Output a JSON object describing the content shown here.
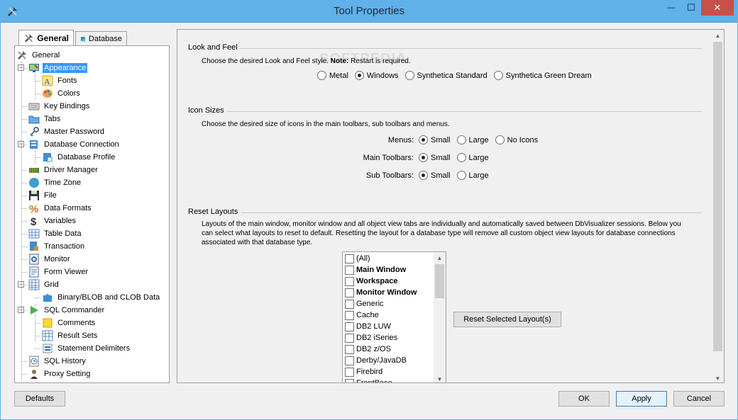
{
  "window": {
    "title": "Tool Properties",
    "minimize_glyph": "—",
    "maximize_glyph": "☐",
    "close_glyph": "✕"
  },
  "tabs": [
    {
      "label": "General",
      "icon": "wrench-screwdriver-icon",
      "active": true
    },
    {
      "label": "Database",
      "icon": "database-icon",
      "active": false
    }
  ],
  "tree": [
    {
      "label": "General",
      "icon": "wrench-screwdriver-icon",
      "level": 0
    },
    {
      "label": "Appearance",
      "icon": "monitor-paint-icon",
      "level": 1,
      "selected": true,
      "expanded": true
    },
    {
      "label": "Fonts",
      "icon": "font-icon",
      "level": 2
    },
    {
      "label": "Colors",
      "icon": "palette-icon",
      "level": 2
    },
    {
      "label": "Key Bindings",
      "icon": "keyboard-icon",
      "level": 1
    },
    {
      "label": "Tabs",
      "icon": "folder-tab-icon",
      "level": 1
    },
    {
      "label": "Master Password",
      "icon": "key-icon",
      "level": 1
    },
    {
      "label": "Database Connection",
      "icon": "database-connection-icon",
      "level": 1,
      "expanded": true
    },
    {
      "label": "Database Profile",
      "icon": "database-profile-icon",
      "level": 2
    },
    {
      "label": "Driver Manager",
      "icon": "driver-icon",
      "level": 1
    },
    {
      "label": "Time Zone",
      "icon": "globe-icon",
      "level": 1
    },
    {
      "label": "File",
      "icon": "floppy-disk-icon",
      "level": 1
    },
    {
      "label": "Data Formats",
      "icon": "percent-icon",
      "level": 1
    },
    {
      "label": "Variables",
      "icon": "dollar-icon",
      "level": 1
    },
    {
      "label": "Table Data",
      "icon": "table-icon",
      "level": 1
    },
    {
      "label": "Transaction",
      "icon": "transaction-icon",
      "level": 1
    },
    {
      "label": "Monitor",
      "icon": "monitor-icon",
      "level": 1
    },
    {
      "label": "Form Viewer",
      "icon": "form-icon",
      "level": 1
    },
    {
      "label": "Grid",
      "icon": "grid-icon",
      "level": 1,
      "expanded": true
    },
    {
      "label": "Binary/BLOB and CLOB Data",
      "icon": "puzzle-icon",
      "level": 2
    },
    {
      "label": "SQL Commander",
      "icon": "play-icon",
      "level": 1,
      "expanded": true
    },
    {
      "label": "Comments",
      "icon": "note-icon",
      "level": 2
    },
    {
      "label": "Result Sets",
      "icon": "result-grid-icon",
      "level": 2
    },
    {
      "label": "Statement Delimiters",
      "icon": "delimiter-icon",
      "level": 2
    },
    {
      "label": "SQL History",
      "icon": "clock-icon",
      "level": 1
    },
    {
      "label": "Proxy Setting",
      "icon": "person-icon",
      "level": 1
    }
  ],
  "look_and_feel": {
    "title": "Look and Feel",
    "desc_prefix": "Choose the desired Look and Feel style.",
    "desc_note_label": "Note:",
    "desc_note": "Restart is required.",
    "options": [
      {
        "label": "Metal",
        "checked": false
      },
      {
        "label": "Windows",
        "checked": true
      },
      {
        "label": "Synthetica Standard",
        "checked": false
      },
      {
        "label": "Synthetica Green Dream",
        "checked": false
      }
    ]
  },
  "icon_sizes": {
    "title": "Icon Sizes",
    "desc": "Choose the desired size of icons in the main toolbars, sub toolbars and menus.",
    "rows": [
      {
        "label": "Menus:",
        "options": [
          {
            "label": "Small",
            "checked": true
          },
          {
            "label": "Large",
            "checked": false
          },
          {
            "label": "No Icons",
            "checked": false
          }
        ]
      },
      {
        "label": "Main Toolbars:",
        "options": [
          {
            "label": "Small",
            "checked": true
          },
          {
            "label": "Large",
            "checked": false
          }
        ]
      },
      {
        "label": "Sub Toolbars:",
        "options": [
          {
            "label": "Small",
            "checked": true
          },
          {
            "label": "Large",
            "checked": false
          }
        ]
      }
    ]
  },
  "reset_layouts": {
    "title": "Reset Layouts",
    "desc_line1": "Layouts of the main window, monitor window and all object view tabs are individually and automatically saved between DbVisualizer sessions. Below you",
    "desc_line2": "can select what layouts to reset to default. Resetting the layout for a database type will remove all custom object view layouts for database connections",
    "desc_line3": "associated with that database type.",
    "items": [
      {
        "label": "(All)",
        "bold": false
      },
      {
        "label": "Main Window",
        "bold": true
      },
      {
        "label": "Workspace",
        "bold": true
      },
      {
        "label": "Monitor Window",
        "bold": true
      },
      {
        "label": "Generic",
        "bold": false
      },
      {
        "label": "Cache",
        "bold": false
      },
      {
        "label": "DB2 LUW",
        "bold": false
      },
      {
        "label": "DB2 iSeries",
        "bold": false
      },
      {
        "label": "DB2 z/OS",
        "bold": false
      },
      {
        "label": "Derby/JavaDB",
        "bold": false
      },
      {
        "label": "Firebird",
        "bold": false
      },
      {
        "label": "FrontBase",
        "bold": false
      }
    ],
    "reset_button": "Reset Selected Layout(s)"
  },
  "watermark": "SOFTPEDIA",
  "footer": {
    "defaults": "Defaults",
    "ok": "OK",
    "apply": "Apply",
    "cancel": "Cancel"
  }
}
